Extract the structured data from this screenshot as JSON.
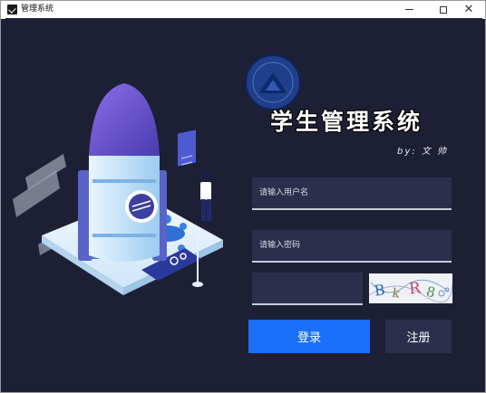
{
  "window": {
    "title": "管理系统",
    "minimize_icon": "minimize-icon",
    "maximize_icon": "maximize-icon",
    "close_icon": "close-icon",
    "close_glyph": "✕"
  },
  "header": {
    "system_title": "学生管理系统",
    "author": "by: 文 帅"
  },
  "form": {
    "username_placeholder": "请输入用户名",
    "password_placeholder": "请输入密码",
    "captcha_value": "",
    "captcha_text": "BkR8",
    "login_label": "登录",
    "register_label": "注册"
  },
  "colors": {
    "background": "#1d2035",
    "field_background": "#2c2f4c",
    "login_button": "#1a6ffb",
    "register_button": "#2c2f4c"
  }
}
